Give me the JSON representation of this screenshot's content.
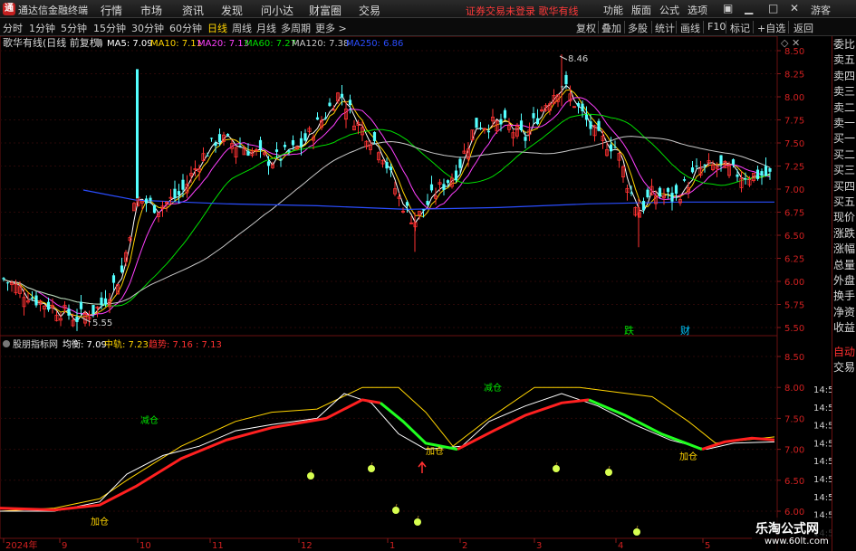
{
  "app": {
    "title": "通达信金融终端",
    "logo_text": "通"
  },
  "menu": [
    "行情",
    "市场",
    "资讯",
    "发现",
    "问小达",
    "财富圈",
    "交易"
  ],
  "login_status": "证券交易未登录  歌华有线",
  "top_right": [
    "功能",
    "版面",
    "公式",
    "选项"
  ],
  "guest_label": "游客",
  "periods": [
    {
      "label": "分时",
      "active": false
    },
    {
      "label": "1分钟",
      "active": false
    },
    {
      "label": "5分钟",
      "active": false
    },
    {
      "label": "15分钟",
      "active": false
    },
    {
      "label": "30分钟",
      "active": false
    },
    {
      "label": "60分钟",
      "active": false
    },
    {
      "label": "日线",
      "active": true
    },
    {
      "label": "周线",
      "active": false
    },
    {
      "label": "月线",
      "active": false
    },
    {
      "label": "多周期",
      "active": false
    },
    {
      "label": "更多 >",
      "active": false
    }
  ],
  "tools": [
    "复权",
    "叠加",
    "多股",
    "统计",
    "画线",
    "F10",
    "标记",
    "+自选",
    "返回"
  ],
  "main_chart": {
    "stock_label": "歌华有线(日线 前复权)",
    "ma": [
      {
        "label": "MA5: 7.09",
        "color": "#ffffff"
      },
      {
        "label": "MA10: 7.11",
        "color": "#ffd400"
      },
      {
        "label": "MA20: 7.13",
        "color": "#ff40ff"
      },
      {
        "label": "MA60: 7.27",
        "color": "#00e000"
      },
      {
        "label": "MA120: 7.38",
        "color": "#c8c8c8"
      },
      {
        "label": "MA250: 6.86",
        "color": "#2a4dff"
      }
    ],
    "y_ticks": [
      "8.50",
      "8.25",
      "8.00",
      "7.75",
      "7.50",
      "7.25",
      "7.00",
      "6.75",
      "6.50",
      "6.25",
      "6.00",
      "5.75",
      "5.50"
    ],
    "high_label": "8.46",
    "low_label": "5.55",
    "markers": [
      {
        "text": "跌",
        "color": "#00e000"
      },
      {
        "text": "财",
        "color": "#00c8ff"
      }
    ]
  },
  "sub_chart": {
    "name": "股朋指标网",
    "legend": [
      {
        "label": "均衡: 7.09",
        "color": "#ffffff"
      },
      {
        "label": "中轨: 7.23",
        "color": "#ffd400"
      },
      {
        "label": "趋势: 7.16 : 7.13",
        "color": "#ff3030"
      }
    ],
    "y_ticks": [
      "8.50",
      "8.00",
      "7.50",
      "7.00",
      "6.50",
      "6.00"
    ],
    "signals": [
      {
        "text": "减仓",
        "color": "#00e000"
      },
      {
        "text": "减仓",
        "color": "#00e000"
      },
      {
        "text": "加仓",
        "color": "#ffd400"
      },
      {
        "text": "加仓",
        "color": "#ffd400"
      },
      {
        "text": "加仓",
        "color": "#ffd400"
      }
    ],
    "apple_icon": "apple-icon",
    "arrow_icon": "up-arrow-icon"
  },
  "x_axis": [
    "2024年",
    "9",
    "10",
    "11",
    "12",
    "1",
    "2",
    "3",
    "4",
    "5"
  ],
  "side_tabs_top": [
    {
      "label": "委比",
      "red": false
    },
    {
      "label": "卖五",
      "red": false
    },
    {
      "label": "卖四",
      "red": false
    },
    {
      "label": "卖三",
      "red": false
    },
    {
      "label": "卖二",
      "red": false
    },
    {
      "label": "卖一",
      "red": false
    },
    {
      "label": "买一",
      "red": false
    },
    {
      "label": "买二",
      "red": false
    },
    {
      "label": "买三",
      "red": false
    },
    {
      "label": "买四",
      "red": false
    },
    {
      "label": "买五",
      "red": false
    },
    {
      "label": "现价",
      "red": false
    },
    {
      "label": "涨跌",
      "red": false
    },
    {
      "label": "涨幅",
      "red": false
    },
    {
      "label": "总量",
      "red": false
    },
    {
      "label": "外盘",
      "red": false
    },
    {
      "label": "换手",
      "red": false
    },
    {
      "label": "净资",
      "red": false
    },
    {
      "label": "收益",
      "red": false
    }
  ],
  "side_tabs_bottom": [
    {
      "label": "自动",
      "red": true
    },
    {
      "label": "交易",
      "red": false
    }
  ],
  "time_labels": [
    "14:56",
    "14:56",
    "14:56",
    "14:56",
    "14:56",
    "14:56",
    "14:56",
    "14:56",
    "14:56"
  ],
  "watermark": {
    "line1": "乐淘公式网",
    "line2": "www.60lt.com"
  }
}
